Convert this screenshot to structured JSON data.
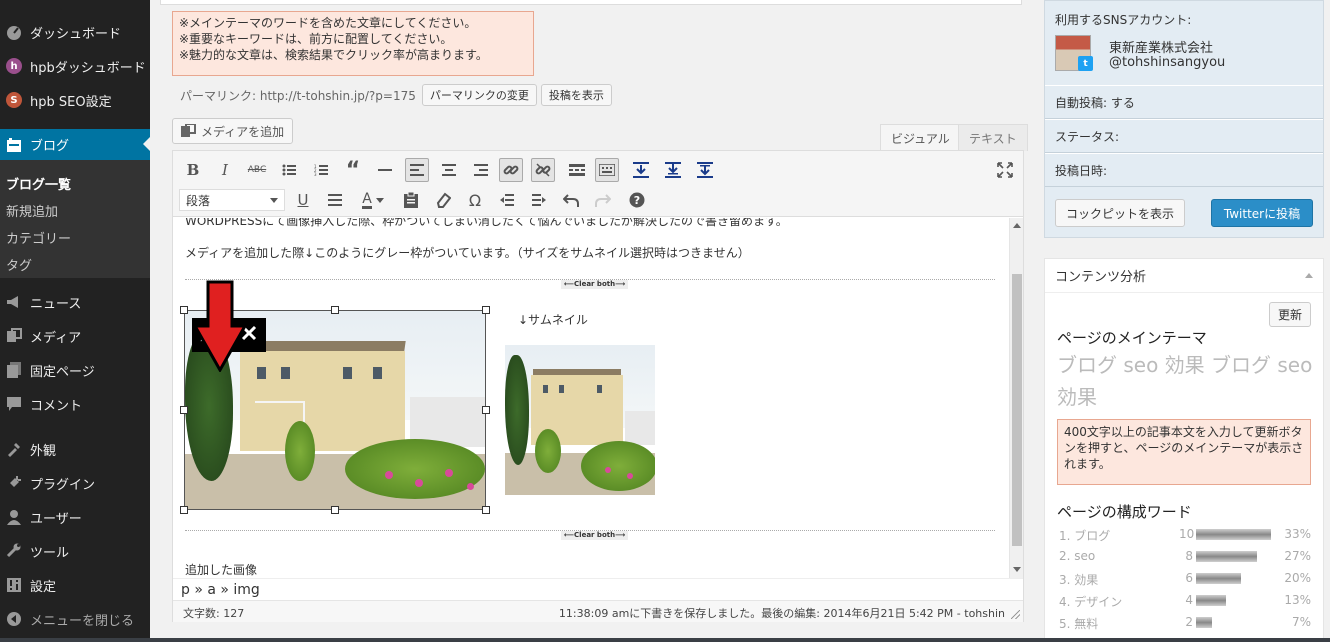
{
  "sidebar": {
    "items": [
      {
        "label": "ダッシュボード",
        "icon": "dashboard-icon"
      },
      {
        "label": "hpbダッシュボード",
        "icon": "hpb-icon"
      },
      {
        "label": "hpb SEO設定",
        "icon": "seo-icon"
      },
      {
        "label": "ブログ",
        "icon": "blog-icon"
      },
      {
        "label": "ニュース",
        "icon": "megaphone-icon"
      },
      {
        "label": "メディア",
        "icon": "media-icon"
      },
      {
        "label": "固定ページ",
        "icon": "page-icon"
      },
      {
        "label": "コメント",
        "icon": "comment-icon"
      },
      {
        "label": "外観",
        "icon": "appearance-icon"
      },
      {
        "label": "プラグイン",
        "icon": "plugin-icon"
      },
      {
        "label": "ユーザー",
        "icon": "user-icon"
      },
      {
        "label": "ツール",
        "icon": "wrench-icon"
      },
      {
        "label": "設定",
        "icon": "settings-icon"
      },
      {
        "label": "メニューを閉じる",
        "icon": "collapse-icon"
      }
    ],
    "submenu": [
      "ブログ一覧",
      "新規追加",
      "カテゴリー",
      "タグ"
    ],
    "accent": "#0074a2"
  },
  "notice": {
    "lines": [
      "※メインテーマのワードを含めた文章にしてください。",
      "※重要なキーワードは、前方に配置してください。",
      "※魅力的な文章は、検索結果でクリック率が高まります。"
    ]
  },
  "permalink": {
    "label": "パーマリンク: http://t-tohshin.jp/?p=175",
    "change_button": "パーマリンクの変更",
    "view_button": "投稿を表示"
  },
  "editor": {
    "add_media": "メディアを追加",
    "tab_visual": "ビジュアル",
    "tab_text": "テキスト",
    "format_select": "段落",
    "content": {
      "line1": "WORDPRESSにて画像挿入した際、枠がついてしまい消したくて悩んでいましたが解決したので書き留めます。",
      "line2": "メディアを追加した際↓このようにグレー枠がついています。（サイズをサムネイル選択時はつきません）",
      "clear_both": "⟵Clear both⟶",
      "thumb_label": "↓サムネイル",
      "added_image_label": "追加した画像"
    },
    "path": "p » a » img",
    "word_count": "文字数: 127",
    "autosave": "11:38:09 amに下書きを保存しました。最後の編集: 2014年6月21日 5:42 PM - tohshin"
  },
  "sns": {
    "title": "利用するSNSアカウント:",
    "account_name": "東新産業株式会社",
    "account_handle": "@tohshinsangyou",
    "auto_post": "自動投稿: する",
    "status": "ステータス:",
    "post_date": "投稿日時:",
    "cockpit_button": "コックピットを表示",
    "twitter_button": "Twitterに投稿"
  },
  "analysis": {
    "title": "コンテンツ分析",
    "update_button": "更新",
    "main_theme_title": "ページのメインテーマ",
    "main_theme_words": "ブログ seo 効果 ブログ seo 効果",
    "info": "400文字以上の記事本文を入力して更新ボタンを押すと、ページのメインテーマが表示されます。",
    "words_title": "ページの構成ワード",
    "words": [
      {
        "name": "1. ブログ",
        "count": "10",
        "pct": "33%",
        "ratio": 0.33
      },
      {
        "name": "2. seo",
        "count": "8",
        "pct": "27%",
        "ratio": 0.27
      },
      {
        "name": "3. 効果",
        "count": "6",
        "pct": "20%",
        "ratio": 0.2
      },
      {
        "name": "4. デザイン",
        "count": "4",
        "pct": "13%",
        "ratio": 0.13
      },
      {
        "name": "5. 無料",
        "count": "2",
        "pct": "7%",
        "ratio": 0.07
      }
    ]
  }
}
